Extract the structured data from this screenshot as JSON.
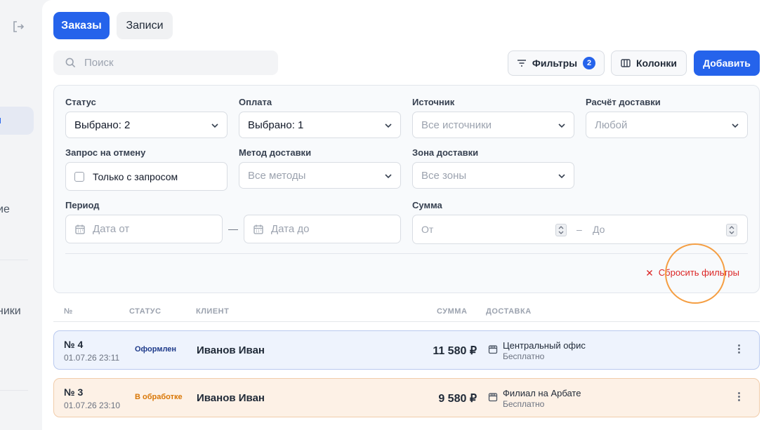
{
  "sidebar": {
    "active_fragment": "и",
    "fragment_1": "ие",
    "fragment_2": "ники"
  },
  "tabs": [
    {
      "label": "Заказы",
      "active": true
    },
    {
      "label": "Записи",
      "active": false
    }
  ],
  "search": {
    "placeholder": "Поиск",
    "value": ""
  },
  "toolbar": {
    "filters_label": "Фильтры",
    "filters_count": "2",
    "columns_label": "Колонки",
    "add_label": "Добавить"
  },
  "filters": {
    "status": {
      "label": "Статус",
      "value": "Выбрано: 2"
    },
    "payment": {
      "label": "Оплата",
      "value": "Выбрано: 1"
    },
    "source": {
      "label": "Источник",
      "placeholder": "Все источники"
    },
    "delivery_calc": {
      "label": "Расчёт доставки",
      "placeholder": "Любой"
    },
    "cancel_request": {
      "label": "Запрос на отмену",
      "checkbox_label": "Только с запросом",
      "checked": false
    },
    "delivery_method": {
      "label": "Метод доставки",
      "placeholder": "Все методы"
    },
    "delivery_zone": {
      "label": "Зона доставки",
      "placeholder": "Все зоны"
    },
    "period": {
      "label": "Период",
      "from_placeholder": "Дата от",
      "to_placeholder": "Дата до",
      "separator": "—"
    },
    "sum": {
      "label": "Сумма",
      "from_placeholder": "От",
      "to_placeholder": "До",
      "separator": "–"
    },
    "reset_label": "Сбросить фильтры"
  },
  "table": {
    "columns": [
      "№",
      "СТАТУС",
      "КЛИЕНТ",
      "СУММА",
      "ДОСТАВКА"
    ],
    "rows": [
      {
        "number": "№ 4",
        "date": "01.07.26 23:11",
        "status": "Оформлен",
        "client": "Иванов Иван",
        "sum": "11 580 ₽",
        "delivery_name": "Центральный офис",
        "delivery_price": "Бесплатно"
      },
      {
        "number": "№ 3",
        "date": "01.07.26 23:10",
        "status": "В обработке",
        "client": "Иванов Иван",
        "sum": "9 580 ₽",
        "delivery_name": "Филиал на Арбате",
        "delivery_price": "Бесплатно"
      }
    ]
  },
  "colors": {
    "primary": "#2563eb",
    "status_registered": "#1e3a8a",
    "status_processing": "#d97706",
    "danger": "#dc2626",
    "highlight_ring": "#f59e42"
  }
}
